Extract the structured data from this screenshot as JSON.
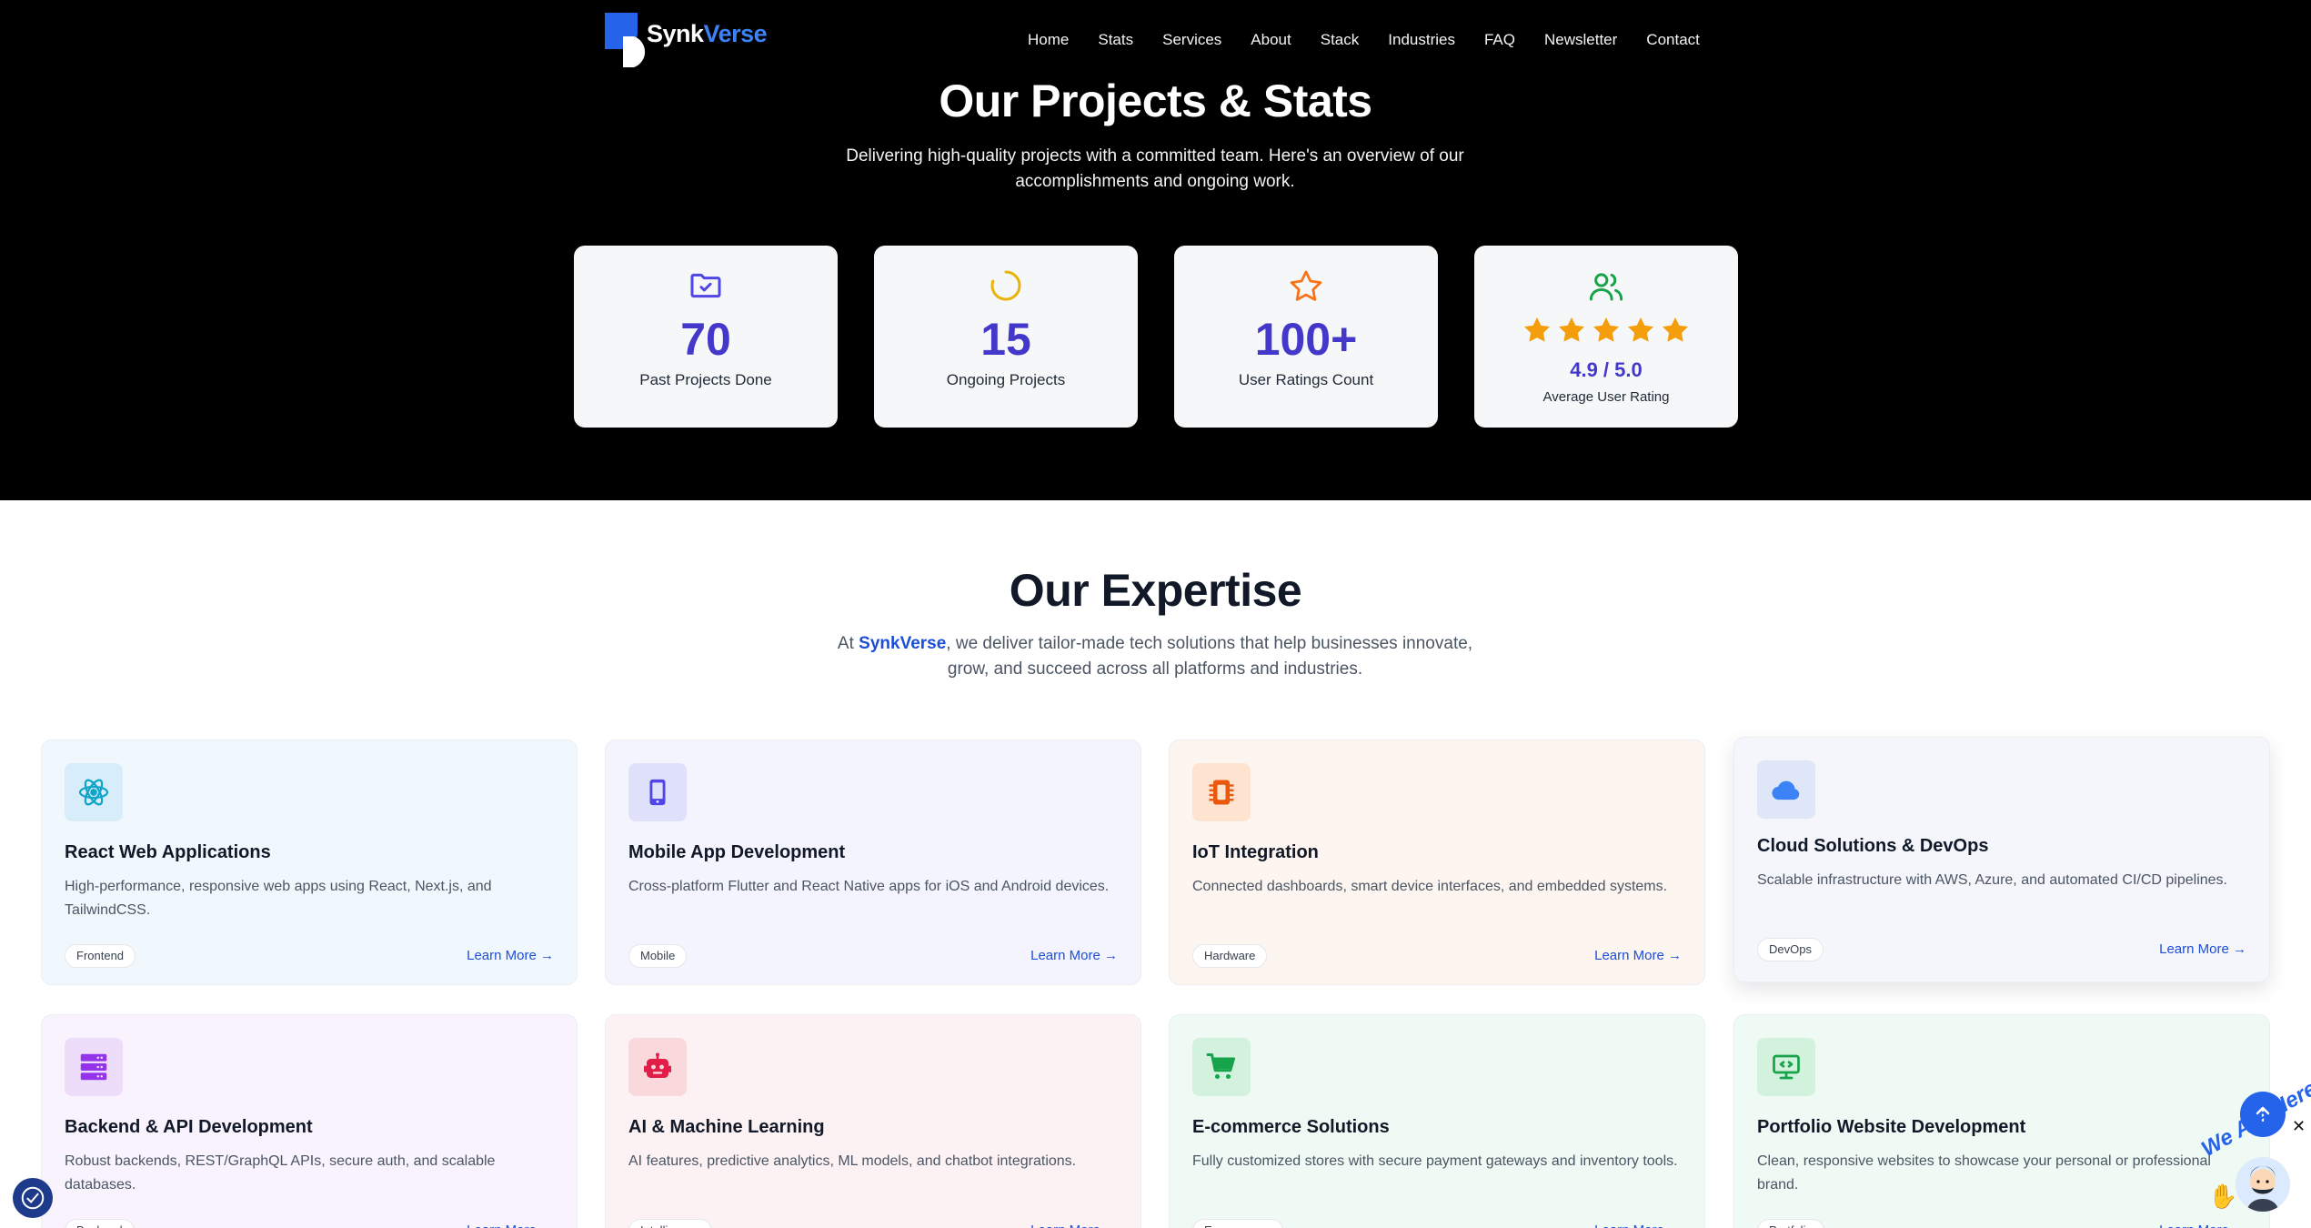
{
  "header": {
    "logo": {
      "part1": "Synk",
      "part2": "Verse"
    },
    "nav": [
      "Home",
      "Stats",
      "Services",
      "About",
      "Stack",
      "Industries",
      "FAQ",
      "Newsletter",
      "Contact"
    ]
  },
  "hero": {
    "title": "Our Projects & Stats",
    "subtitle": "Delivering high-quality projects with a committed team. Here's an overview of our accomplishments and ongoing work."
  },
  "stats": [
    {
      "icon": "folder-check-icon",
      "value": "70",
      "label": "Past Projects Done",
      "color": "#4f46e5"
    },
    {
      "icon": "loading-spinner-icon",
      "value": "15",
      "label": "Ongoing Projects",
      "color": "#eab308"
    },
    {
      "icon": "star-outline-icon",
      "value": "100+",
      "label": "User Ratings Count",
      "color": "#f97316"
    },
    {
      "icon": "users-icon",
      "value": "4.9 / 5.0",
      "label": "Average User Rating",
      "color": "#16a34a",
      "stars": 5
    }
  ],
  "expertise": {
    "title": "Our Expertise",
    "subtitle_prefix": "At ",
    "brand": "SynkVerse",
    "subtitle_suffix": ", we deliver tailor-made tech solutions that help businesses innovate, grow, and succeed across all platforms and industries.",
    "learn_more": "Learn More →",
    "cards": [
      {
        "icon": "react-atom-icon",
        "title": "React Web Applications",
        "desc": "High-performance, responsive web apps using React, Next.js, and TailwindCSS.",
        "tag": "Frontend",
        "bg": "#f1f8fd",
        "icon_bg": "#d7eefa",
        "icon_color": "#0ea5c9"
      },
      {
        "icon": "smartphone-icon",
        "title": "Mobile App Development",
        "desc": "Cross-platform Flutter and React Native apps for iOS and Android devices.",
        "tag": "Mobile",
        "bg": "#f3f4fd",
        "icon_bg": "#dfe1fb",
        "icon_color": "#4f46e5"
      },
      {
        "icon": "chip-icon",
        "title": "IoT Integration",
        "desc": "Connected dashboards, smart device interfaces, and embedded systems.",
        "tag": "Hardware",
        "bg": "#fdf5ef",
        "icon_bg": "#fde3d0",
        "icon_color": "#ea580c"
      },
      {
        "icon": "cloud-icon",
        "title": "Cloud Solutions & DevOps",
        "desc": "Scalable infrastructure with AWS, Azure, and automated CI/CD pipelines.",
        "tag": "DevOps",
        "bg": "#f4f6fb",
        "icon_bg": "#dfe6f7",
        "icon_color": "#3b82f6"
      },
      {
        "icon": "server-icon",
        "title": "Backend & API Development",
        "desc": "Robust backends, REST/GraphQL APIs, secure auth, and scalable databases.",
        "tag": "Backend",
        "bg": "#f8f3fd",
        "icon_bg": "#eddcfa",
        "icon_color": "#9333ea"
      },
      {
        "icon": "robot-icon",
        "title": "AI & Machine Learning",
        "desc": "AI features, predictive analytics, ML models, and chatbot integrations.",
        "tag": "Intelligence",
        "bg": "#fdf2f3",
        "icon_bg": "#fad9dc",
        "icon_color": "#e11d48"
      },
      {
        "icon": "shopping-cart-icon",
        "title": "E-commerce Solutions",
        "desc": "Fully customized stores with secure payment gateways and inventory tools.",
        "tag": "E-commerce",
        "bg": "#f0faf4",
        "icon_bg": "#d3f2de",
        "icon_color": "#16a34a"
      },
      {
        "icon": "monitor-code-icon",
        "title": "Portfolio Website Development",
        "desc": "Clean, responsive websites to showcase your personal or professional brand.",
        "tag": "Portfolio",
        "bg": "#f0faf5",
        "icon_bg": "#d3f2de",
        "icon_color": "#16a34a"
      }
    ]
  },
  "floating": {
    "here_text": "We Are Here",
    "close": "✕"
  }
}
